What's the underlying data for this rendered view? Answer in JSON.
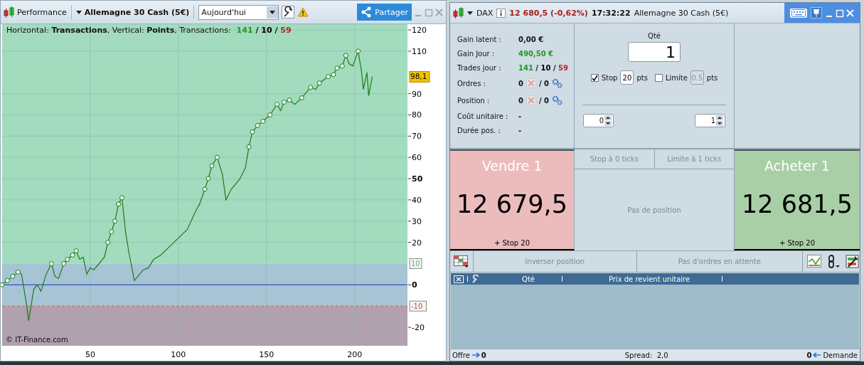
{
  "left_window": {
    "title": "Performance",
    "instrument": "Allemagne 30 Cash (5€)",
    "period": "Aujourd'hui",
    "share_button": "Partager",
    "legend": "Horizontal: **Transactions**, Vertical: **Points**, Transactions:",
    "counts": [
      {
        "value": "141",
        "color": "#1f9a1f"
      },
      {
        "value": "10",
        "color": "#000000"
      },
      {
        "value": "59",
        "color": "#b02a2a"
      }
    ],
    "count_separator": "/",
    "copyright": "© IT-Finance.com",
    "threshold_labels": [
      {
        "value": "10",
        "kind": "upper"
      },
      {
        "value": "-10",
        "kind": "lower"
      }
    ],
    "current_value": {
      "label": "98,1"
    },
    "chart_data": {
      "type": "line",
      "grid": true,
      "ref_lines": [
        {
          "axis": "y",
          "value": 0,
          "color": "#1a3ad0"
        },
        {
          "axis": "y",
          "value": -10,
          "color": "#c06060"
        }
      ],
      "bands": [
        {
          "axis": "y",
          "from": 10,
          "to": 122.7,
          "color": "#a2dbbe"
        },
        {
          "axis": "y",
          "from": -10,
          "to": 10,
          "color": "#a6c4d4"
        },
        {
          "axis": "y",
          "from": -28.7,
          "to": -10,
          "color": "#b1a0ad"
        }
      ],
      "xlim": [
        0,
        230
      ],
      "ylim": [
        -28.7,
        122.7
      ],
      "xticks": [
        50,
        100,
        150,
        200
      ],
      "yticks": [
        120,
        110,
        90,
        80,
        70,
        60,
        50,
        40,
        30,
        20,
        0,
        -20
      ],
      "x": [
        0,
        3,
        6,
        9,
        11,
        13,
        14,
        15,
        16,
        18,
        20,
        22,
        25,
        28,
        30,
        32,
        35,
        37,
        40,
        42,
        44,
        46,
        48,
        50,
        52,
        55,
        58,
        60,
        62,
        64,
        66,
        68,
        70,
        72,
        75,
        78,
        80,
        83,
        86,
        90,
        95,
        100,
        105,
        110,
        112,
        115,
        117,
        119,
        122,
        125,
        127,
        130,
        135,
        138,
        140,
        142,
        145,
        148,
        152,
        156,
        158,
        160,
        163,
        166,
        170,
        175,
        178,
        180,
        185,
        188,
        190,
        193,
        195,
        197,
        199,
        202,
        204,
        205,
        207,
        208,
        210
      ],
      "series": [
        {
          "color": "#1e7a1e",
          "values": [
            0,
            2,
            4,
            6,
            5,
            -5,
            -10,
            -17,
            -12,
            -2,
            0,
            -3,
            5,
            10,
            4,
            3,
            10,
            12,
            14,
            16,
            12,
            13,
            5,
            8,
            7,
            10,
            13,
            20,
            25,
            30,
            38,
            41,
            25,
            15,
            2,
            5,
            7,
            8,
            12,
            14,
            18,
            22,
            26,
            35,
            38,
            45,
            50,
            56,
            60,
            52,
            40,
            45,
            50,
            55,
            65,
            72,
            75,
            77,
            80,
            85,
            82,
            86,
            87,
            85,
            88,
            93,
            92,
            95,
            98,
            99,
            102,
            103,
            108,
            104,
            103,
            110,
            100,
            92,
            100,
            89,
            98
          ]
        }
      ]
    }
  },
  "right_window": {
    "instrument": "DAX",
    "price": "12 680,5 (-0,62%)",
    "time": "17:32:22",
    "name": "Allemagne 30 Cash (5€)",
    "stats": [
      {
        "kind": "plain",
        "label": "Gain latent :",
        "value": "0,00 €"
      },
      {
        "kind": "gain",
        "label": "Gain Jour :",
        "value": "490,50 €"
      },
      {
        "kind": "counts",
        "label": "Trades jour :",
        "counts": [
          {
            "value": "141",
            "color": "#1f9a1f"
          },
          {
            "value": "10",
            "color": "#000000"
          },
          {
            "value": "59",
            "color": "#b02a2a"
          }
        ],
        "separator": "/"
      },
      {
        "kind": "orders",
        "label": "Ordres :",
        "first": "0",
        "separator": "/",
        "second": "0"
      },
      {
        "kind": "orders",
        "label": "Position :",
        "first": "0",
        "separator": "/",
        "second": "0"
      },
      {
        "kind": "dash",
        "label": "Coût unitaire :",
        "value": "-"
      },
      {
        "kind": "dash",
        "label": "Durée pos. :",
        "value": "-"
      }
    ],
    "quantity": {
      "label": "Qté",
      "value": "1"
    },
    "stop": {
      "label": "Stop",
      "checked": true,
      "value": "20",
      "unit": "pts",
      "disabled": false
    },
    "limit": {
      "label": "Limite",
      "checked": false,
      "value": "0.5",
      "unit": "pts",
      "disabled": true
    },
    "spinners": [
      {
        "value": "0"
      },
      {
        "value": "1"
      }
    ],
    "sell": {
      "label": "Vendre 1",
      "price": "12 679,5",
      "note": "+ Stop 20"
    },
    "tick_buttons": [
      "Stop à 0 ticks",
      "Limite à 1 ticks"
    ],
    "position_status": "Pas de position",
    "buy": {
      "label": "Acheter 1",
      "price": "12 681,5",
      "note": "+ Stop 20"
    },
    "actions": [
      "Inverser position",
      "Pas d'ordres en attente"
    ],
    "table": {
      "columns": [
        "Qté",
        "Prix de revient unitaire"
      ]
    },
    "status_bar": {
      "offer_label": "Offre",
      "offer_value": "0",
      "spread": "Spread:  2,0",
      "demand_value": "0",
      "demand_label": "Demande"
    }
  }
}
